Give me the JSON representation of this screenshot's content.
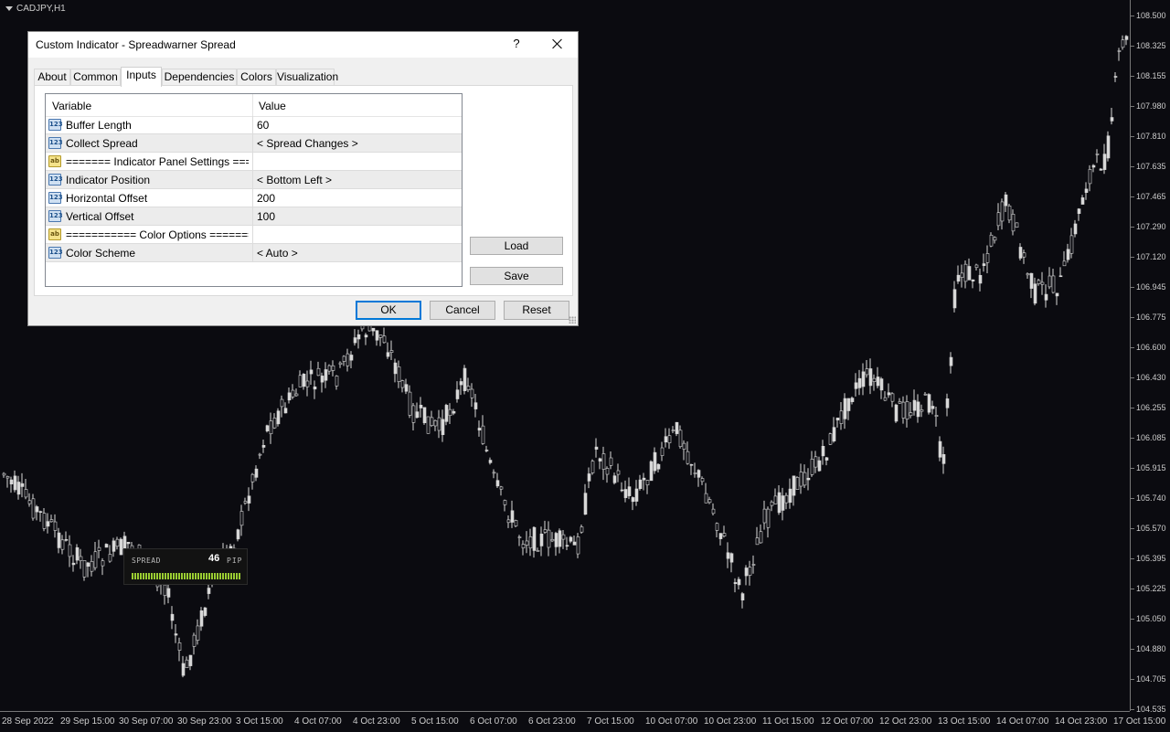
{
  "chart": {
    "symbol": "CADJPY,H1",
    "price_axis": [
      "108.500",
      "108.325",
      "108.155",
      "107.980",
      "107.810",
      "107.635",
      "107.465",
      "107.290",
      "107.120",
      "106.945",
      "106.775",
      "106.600",
      "106.430",
      "106.255",
      "106.085",
      "105.915",
      "105.740",
      "105.570",
      "105.395",
      "105.225",
      "105.050",
      "104.880",
      "104.705",
      "104.535"
    ],
    "time_axis": [
      "28 Sep 2022",
      "29 Sep 15:00",
      "30 Sep 07:00",
      "30 Sep 23:00",
      "3 Oct 15:00",
      "4 Oct 07:00",
      "4 Oct 23:00",
      "5 Oct 15:00",
      "6 Oct 07:00",
      "6 Oct 23:00",
      "7 Oct 15:00",
      "10 Oct 07:00",
      "10 Oct 23:00",
      "11 Oct 15:00",
      "12 Oct 07:00",
      "12 Oct 23:00",
      "13 Oct 15:00",
      "14 Oct 07:00",
      "14 Oct 23:00",
      "17 Oct 15:00"
    ],
    "candle_color": "#d8d8d8",
    "background": "#0b0b10"
  },
  "spread_widget": {
    "title": "SPREAD",
    "value": "46",
    "unit": "PIP",
    "bar_color": "#9acd32"
  },
  "dialog": {
    "title": "Custom Indicator - Spreadwarner Spread",
    "help_label": "?",
    "tabs": [
      {
        "label": "About"
      },
      {
        "label": "Common"
      },
      {
        "label": "Inputs"
      },
      {
        "label": "Dependencies"
      },
      {
        "label": "Colors"
      },
      {
        "label": "Visualization"
      }
    ],
    "active_tab": "Inputs",
    "grid": {
      "headers": {
        "variable": "Variable",
        "value": "Value"
      },
      "rows": [
        {
          "name": "Buffer Length",
          "value": "60",
          "type": "num",
          "icon": "123"
        },
        {
          "name": "Collect Spread",
          "value": "< Spread Changes >",
          "type": "num",
          "icon": "123"
        },
        {
          "name": "======= Indicator Panel Settings =====...",
          "value": "",
          "type": "str",
          "icon": "ab"
        },
        {
          "name": "Indicator Position",
          "value": "< Bottom Left >",
          "type": "num",
          "icon": "123"
        },
        {
          "name": "Horizontal Offset",
          "value": "200",
          "type": "num",
          "icon": "123"
        },
        {
          "name": "Vertical Offset",
          "value": "100",
          "type": "num",
          "icon": "123"
        },
        {
          "name": "=========== Color Options =========...",
          "value": "",
          "type": "str",
          "icon": "ab"
        },
        {
          "name": "Color Scheme",
          "value": "< Auto >",
          "type": "num",
          "icon": "123"
        }
      ]
    },
    "side_buttons": {
      "load": "Load",
      "save": "Save"
    },
    "footer_buttons": {
      "ok": "OK",
      "cancel": "Cancel",
      "reset": "Reset"
    }
  }
}
